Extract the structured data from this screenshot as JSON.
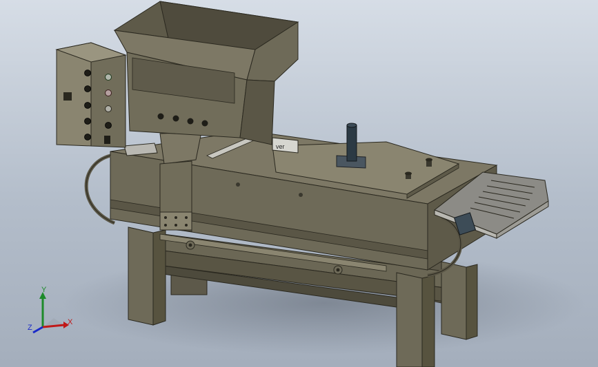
{
  "viewport": {
    "background_top": "#d6dde6",
    "background_bottom": "#a4aebc"
  },
  "model": {
    "body_color": "#6e6a58",
    "body_dark": "#4f4b3d",
    "body_light": "#8a8570",
    "steel_color": "#b9b8b2",
    "hopper_front_label": "",
    "nameplate_text": "ver"
  },
  "axis_triad": {
    "x_label": "X",
    "y_label": "Y",
    "z_label": "Z",
    "x_color": "#c01818",
    "y_color": "#1d8a2a",
    "z_color": "#1a2ac8"
  }
}
